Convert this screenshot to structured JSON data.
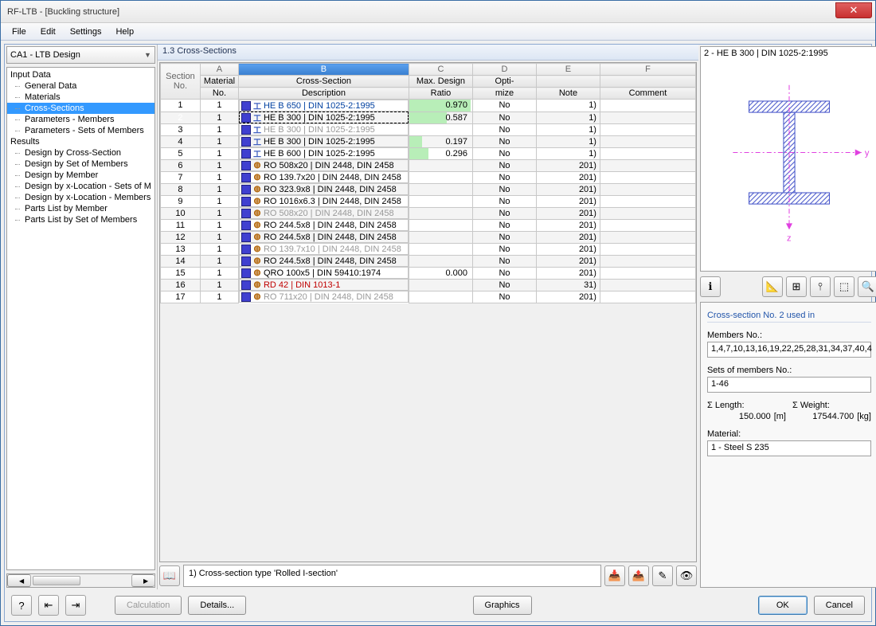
{
  "window": {
    "title": "RF-LTB - [Buckling structure]"
  },
  "menu": {
    "file": "File",
    "edit": "Edit",
    "settings": "Settings",
    "help": "Help"
  },
  "left": {
    "combo": "CA1 - LTB Design",
    "groups": {
      "input": "Input Data",
      "results": "Results"
    },
    "items": {
      "general": "General Data",
      "materials": "Materials",
      "cross": "Cross-Sections",
      "param_m": "Parameters - Members",
      "param_s": "Parameters - Sets of Members",
      "d_cs": "Design by Cross-Section",
      "d_som": "Design by Set of Members",
      "d_m": "Design by Member",
      "d_xloc_s": "Design by x-Location - Sets of M",
      "d_xloc_m": "Design by x-Location - Members",
      "pl_m": "Parts List by Member",
      "pl_som": "Parts List by Set of Members"
    }
  },
  "panel_title": "1.3 Cross-Sections",
  "columns": {
    "letters": {
      "a": "A",
      "b": "B",
      "c": "C",
      "d": "D",
      "e": "E",
      "f": "F"
    },
    "h1": {
      "section": "Section",
      "material": "Material",
      "cs": "Cross-Section",
      "ratio": "Max. Design",
      "opt": "Opti-",
      "note": "",
      "comment": ""
    },
    "h2": {
      "section": "No.",
      "material": "No.",
      "cs": "Description",
      "ratio": "Ratio",
      "opt": "mize",
      "note": "Note",
      "comment": "Comment"
    }
  },
  "rows": [
    {
      "no": "1",
      "mat": "1",
      "type": "I",
      "desc": "HE B 650 | DIN 1025-2:1995",
      "cls": "blue",
      "ratio": "0.970",
      "rbar": 97,
      "opt": "No",
      "note": "1)"
    },
    {
      "no": "2",
      "mat": "1",
      "type": "I",
      "desc": "HE B 300 | DIN 1025-2:1995",
      "cls": "",
      "ratio": "0.587",
      "rbar": 59,
      "opt": "No",
      "note": "1)",
      "sel": true
    },
    {
      "no": "3",
      "mat": "1",
      "type": "I",
      "desc": "HE B 300 | DIN 1025-2:1995",
      "cls": "gray",
      "ratio": "",
      "rbar": 0,
      "opt": "No",
      "note": "1)"
    },
    {
      "no": "4",
      "mat": "1",
      "type": "I",
      "desc": "HE B 300 | DIN 1025-2:1995",
      "cls": "",
      "ratio": "0.197",
      "rbar": 20,
      "opt": "No",
      "note": "1)"
    },
    {
      "no": "5",
      "mat": "1",
      "type": "I",
      "desc": "HE B 600 | DIN 1025-2:1995",
      "cls": "",
      "ratio": "0.296",
      "rbar": 30,
      "opt": "No",
      "note": "1)"
    },
    {
      "no": "6",
      "mat": "1",
      "type": "O",
      "desc": "RO 508x20 | DIN 2448, DIN 2458",
      "cls": "",
      "ratio": "",
      "rbar": 0,
      "opt": "No",
      "note": "201)"
    },
    {
      "no": "7",
      "mat": "1",
      "type": "O",
      "desc": "RO 139.7x20 | DIN 2448, DIN 2458",
      "cls": "",
      "ratio": "",
      "rbar": 0,
      "opt": "No",
      "note": "201)"
    },
    {
      "no": "8",
      "mat": "1",
      "type": "O",
      "desc": "RO 323.9x8 | DIN 2448, DIN 2458",
      "cls": "",
      "ratio": "",
      "rbar": 0,
      "opt": "No",
      "note": "201)"
    },
    {
      "no": "9",
      "mat": "1",
      "type": "O",
      "desc": "RO 1016x6.3 | DIN 2448, DIN 2458",
      "cls": "",
      "ratio": "",
      "rbar": 0,
      "opt": "No",
      "note": "201)"
    },
    {
      "no": "10",
      "mat": "1",
      "type": "O",
      "desc": "RO 508x20 | DIN 2448, DIN 2458",
      "cls": "gray",
      "ratio": "",
      "rbar": 0,
      "opt": "No",
      "note": "201)"
    },
    {
      "no": "11",
      "mat": "1",
      "type": "O",
      "desc": "RO 244.5x8 | DIN 2448, DIN 2458",
      "cls": "",
      "ratio": "",
      "rbar": 0,
      "opt": "No",
      "note": "201)"
    },
    {
      "no": "12",
      "mat": "1",
      "type": "O",
      "desc": "RO 244.5x8 | DIN 2448, DIN 2458",
      "cls": "",
      "ratio": "",
      "rbar": 0,
      "opt": "No",
      "note": "201)"
    },
    {
      "no": "13",
      "mat": "1",
      "type": "O",
      "desc": "RO 139.7x10 | DIN 2448, DIN 2458",
      "cls": "gray",
      "ratio": "",
      "rbar": 0,
      "opt": "No",
      "note": "201)"
    },
    {
      "no": "14",
      "mat": "1",
      "type": "O",
      "desc": "RO 244.5x8 | DIN 2448, DIN 2458",
      "cls": "",
      "ratio": "",
      "rbar": 0,
      "opt": "No",
      "note": "201)"
    },
    {
      "no": "15",
      "mat": "1",
      "type": "O",
      "desc": "QRO 100x5 | DIN 59410:1974",
      "cls": "",
      "ratio": "0.000",
      "rbar": 0,
      "opt": "No",
      "note": "201)"
    },
    {
      "no": "16",
      "mat": "1",
      "type": "O",
      "desc": "RD 42 | DIN 1013-1",
      "cls": "red",
      "ratio": "",
      "rbar": 0,
      "opt": "No",
      "note": "31)"
    },
    {
      "no": "17",
      "mat": "1",
      "type": "O",
      "desc": "RO 711x20 | DIN 2448, DIN 2458",
      "cls": "gray",
      "ratio": "",
      "rbar": 0,
      "opt": "No",
      "note": "201)"
    }
  ],
  "status": {
    "msg": "1) Cross-section type 'Rolled I-section'"
  },
  "preview": {
    "title": "2 - HE B 300 | DIN 1025-2:1995",
    "y": "y",
    "z": "z"
  },
  "details": {
    "title": "Cross-section No. 2 used in",
    "members_lbl": "Members No.:",
    "members_val": "1,4,7,10,13,16,19,22,25,28,31,34,37,40,4",
    "sets_lbl": "Sets of members No.:",
    "sets_val": "1-46",
    "len_lbl": "Σ Length:",
    "len_val": "150.000",
    "len_unit": "[m]",
    "wt_lbl": "Σ Weight:",
    "wt_val": "17544.700",
    "wt_unit": "[kg]",
    "mat_lbl": "Material:",
    "mat_val": "1 - Steel S 235"
  },
  "buttons": {
    "calc": "Calculation",
    "det": "Details...",
    "gfx": "Graphics",
    "ok": "OK",
    "cancel": "Cancel"
  }
}
